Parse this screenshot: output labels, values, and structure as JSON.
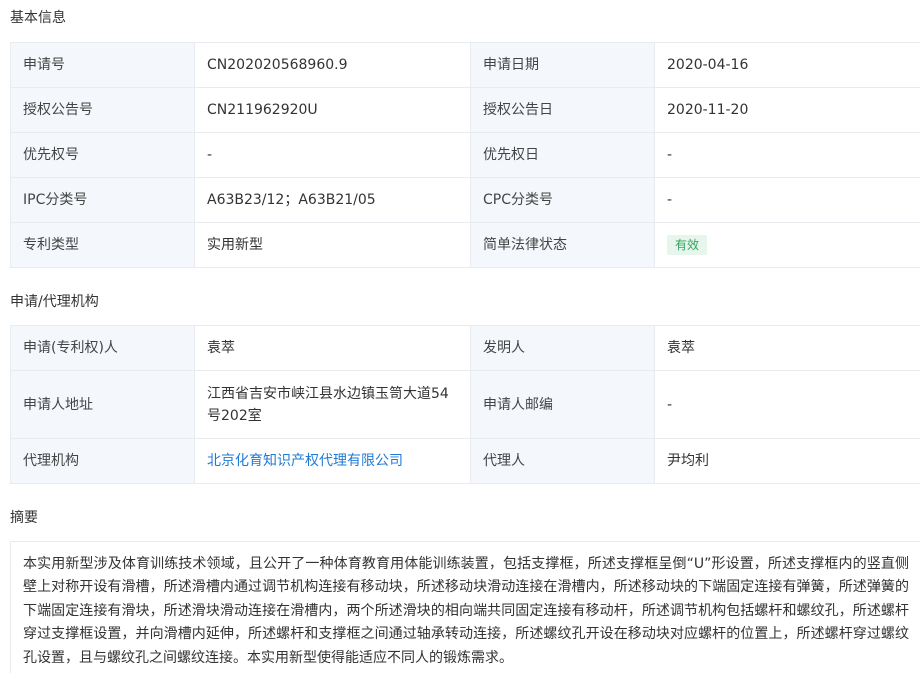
{
  "basic": {
    "title": "基本信息",
    "rows": [
      {
        "l1": "申请号",
        "v1": "CN202020568960.9",
        "l2": "申请日期",
        "v2": "2020-04-16"
      },
      {
        "l1": "授权公告号",
        "v1": "CN211962920U",
        "l2": "授权公告日",
        "v2": "2020-11-20"
      },
      {
        "l1": "优先权号",
        "v1": "-",
        "l2": "优先权日",
        "v2": "-"
      },
      {
        "l1": "IPC分类号",
        "v1": "A63B23/12；A63B21/05",
        "l2": "CPC分类号",
        "v2": "-"
      },
      {
        "l1": "专利类型",
        "v1": "实用新型",
        "l2": "简单法律状态",
        "v2": "有效"
      }
    ],
    "status_colors": {
      "badge_bg": "#e6f6ec",
      "badge_text": "#33a35b"
    }
  },
  "agency": {
    "title": "申请/代理机构",
    "rows": [
      {
        "l1": "申请(专利权)人",
        "v1": "袁萃",
        "l2": "发明人",
        "v2": "袁萃"
      },
      {
        "l1": "申请人地址",
        "v1": "江西省吉安市峡江县水边镇玉笥大道54号202室",
        "l2": "申请人邮编",
        "v2": "-"
      },
      {
        "l1": "代理机构",
        "v1": "北京化育知识产权代理有限公司",
        "l2": "代理人",
        "v2": "尹均利"
      }
    ],
    "link_color": "#1f7ad6"
  },
  "abstract": {
    "title": "摘要",
    "text": "本实用新型涉及体育训练技术领域，且公开了一种体育教育用体能训练装置，包括支撑框，所述支撑框呈倒“U”形设置，所述支撑框内的竖直侧壁上对称开设有滑槽，所述滑槽内通过调节机构连接有移动块，所述移动块滑动连接在滑槽内，所述移动块的下端固定连接有弹簧，所述弹簧的下端固定连接有滑块，所述滑块滑动连接在滑槽内，两个所述滑块的相向端共同固定连接有移动杆，所述调节机构包括螺杆和螺纹孔，所述螺杆穿过支撑框设置，并向滑槽内延伸，所述螺杆和支撑框之间通过轴承转动连接，所述螺纹孔开设在移动块对应螺杆的位置上，所述螺杆穿过螺纹孔设置，且与螺纹孔之间螺纹连接。本实用新型使得能适应不同人的锻炼需求。"
  }
}
